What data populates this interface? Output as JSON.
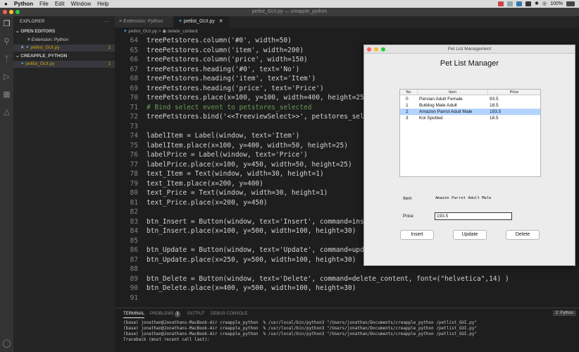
{
  "menubar": {
    "apple": "",
    "items": [
      "Python",
      "File",
      "Edit",
      "Window",
      "Help"
    ],
    "status": {
      "battery": "100%"
    }
  },
  "window": {
    "title": "petlist_GUI.py — creapple_python"
  },
  "explorer": {
    "header": "EXPLORER",
    "more": "···",
    "open_editors_label": "OPEN EDITORS",
    "open_editors": [
      {
        "name": "Extension: Python",
        "badge": ""
      },
      {
        "name": "petlist_GUI.py",
        "badge": "1"
      }
    ],
    "folder_label": "CREAPPLE_PYTHON",
    "folder_files": [
      {
        "name": "petlist_GUI.py",
        "badge": "1"
      }
    ]
  },
  "tabs": [
    {
      "label": "Extension: Python"
    },
    {
      "label": "petlist_GUI.py",
      "close": "✕"
    }
  ],
  "breadcrumb": {
    "file": "petlist_GUI.py",
    "sep": ">",
    "symbol": "delete_content"
  },
  "code_lines": [
    {
      "n": "64",
      "text": "treePetstores.column('#0', width=50)"
    },
    {
      "n": "65",
      "text": "treePetstores.column('item', width=200)"
    },
    {
      "n": "66",
      "text": "treePetstores.column('price', width=150)"
    },
    {
      "n": "67",
      "text": "treePetstores.heading('#0', text='No')"
    },
    {
      "n": "68",
      "text": "treePetstores.heading('item', text='Item')"
    },
    {
      "n": "69",
      "text": "treePetstores.heading('price', text='Price')"
    },
    {
      "n": "70",
      "text": "treePetstores.place(x=100, y=100, width=400, height=250)"
    },
    {
      "n": "71",
      "text": "# Bind select event to petstores_selected"
    },
    {
      "n": "72",
      "text": "treePetstores.bind('<<TreeviewSelect>>', petstores_selected)"
    },
    {
      "n": "73",
      "text": ""
    },
    {
      "n": "74",
      "text": "labelItem = Label(window, text='Item')"
    },
    {
      "n": "75",
      "text": "labelItem.place(x=100, y=400, width=50, height=25)"
    },
    {
      "n": "76",
      "text": "labelPrice = Label(window, text='Price')"
    },
    {
      "n": "77",
      "text": "labelPrice.place(x=100, y=450, width=50, height=25)"
    },
    {
      "n": "78",
      "text": "text_Item = Text(window, width=30, height=1)"
    },
    {
      "n": "79",
      "text": "text_Item.place(x=200, y=400)"
    },
    {
      "n": "80",
      "text": "text_Price = Text(window, width=30, height=1)"
    },
    {
      "n": "81",
      "text": "text_Price.place(x=200, y=450)"
    },
    {
      "n": "82",
      "text": ""
    },
    {
      "n": "83",
      "text": "btn_Insert = Button(window, text='Insert', command=insert_content,"
    },
    {
      "n": "84",
      "text": "btn_Insert.place(x=100, y=500, width=100, height=30)"
    },
    {
      "n": "85",
      "text": ""
    },
    {
      "n": "86",
      "text": "btn_Update = Button(window, text='Update', command=update_content,"
    },
    {
      "n": "87",
      "text": "btn_Update.place(x=250, y=500, width=100, height=30)"
    },
    {
      "n": "88",
      "text": ""
    },
    {
      "n": "89",
      "text": "btn_Delete = Button(window, text='Delete', command=delete_content, font=(\"helvetica\",14) )"
    },
    {
      "n": "90",
      "text": "btn_Delete.place(x=400, y=500, width=100, height=30)"
    },
    {
      "n": "91",
      "text": ""
    }
  ],
  "panel": {
    "tabs": [
      "TERMINAL",
      "PROBLEMS",
      "OUTPUT",
      "DEBUG CONSOLE"
    ],
    "problems_count": "1",
    "terminal_select": "2: Python",
    "terminal_lines": [
      "(base) jonathan@Jonathans-MacBook-Air creapple_python  % /usr/local/bin/python3 \"/Users/jonathan/Documents/creapple_python /petlist_GUI.py\"",
      "(base) jonathan@Jonathans-MacBook-Air creapple_python  % /usr/local/bin/python3 \"/Users/jonathan/Documents/creapple_python /petlist_GUI.py\"",
      "(base) jonathan@Jonathans-MacBook-Air creapple_python  % /usr/local/bin/python3 \"/Users/jonathan/Documents/creapple_python /petlist_GUI.py\"",
      "Traceback (most recent call last):"
    ]
  },
  "app": {
    "window_title": "Pet List Management",
    "heading": "Pet List Manager",
    "columns": [
      "No",
      "Item",
      "Price"
    ],
    "rows": [
      {
        "no": "0",
        "item": "Persian Adult Female",
        "price": "93.5"
      },
      {
        "no": "1",
        "item": "Bulldog Male Adult",
        "price": "18.5"
      },
      {
        "no": "2",
        "item": "Amazon Parrot Adult Male",
        "price": "193.5"
      },
      {
        "no": "3",
        "item": "Koi Spotted",
        "price": "18.5"
      }
    ],
    "selected_row": "2",
    "item_label": "Item",
    "item_value": "Amazon Parrot Adult Male",
    "price_label": "Price",
    "price_value": "193.5",
    "buttons": {
      "insert": "Insert",
      "update": "Update",
      "delete": "Delete"
    }
  },
  "colors": {
    "selection": "#b3d4ff",
    "warning": "#cca700",
    "close": "#ff5f57",
    "minimize": "#febc2e",
    "zoom": "#28c840"
  }
}
